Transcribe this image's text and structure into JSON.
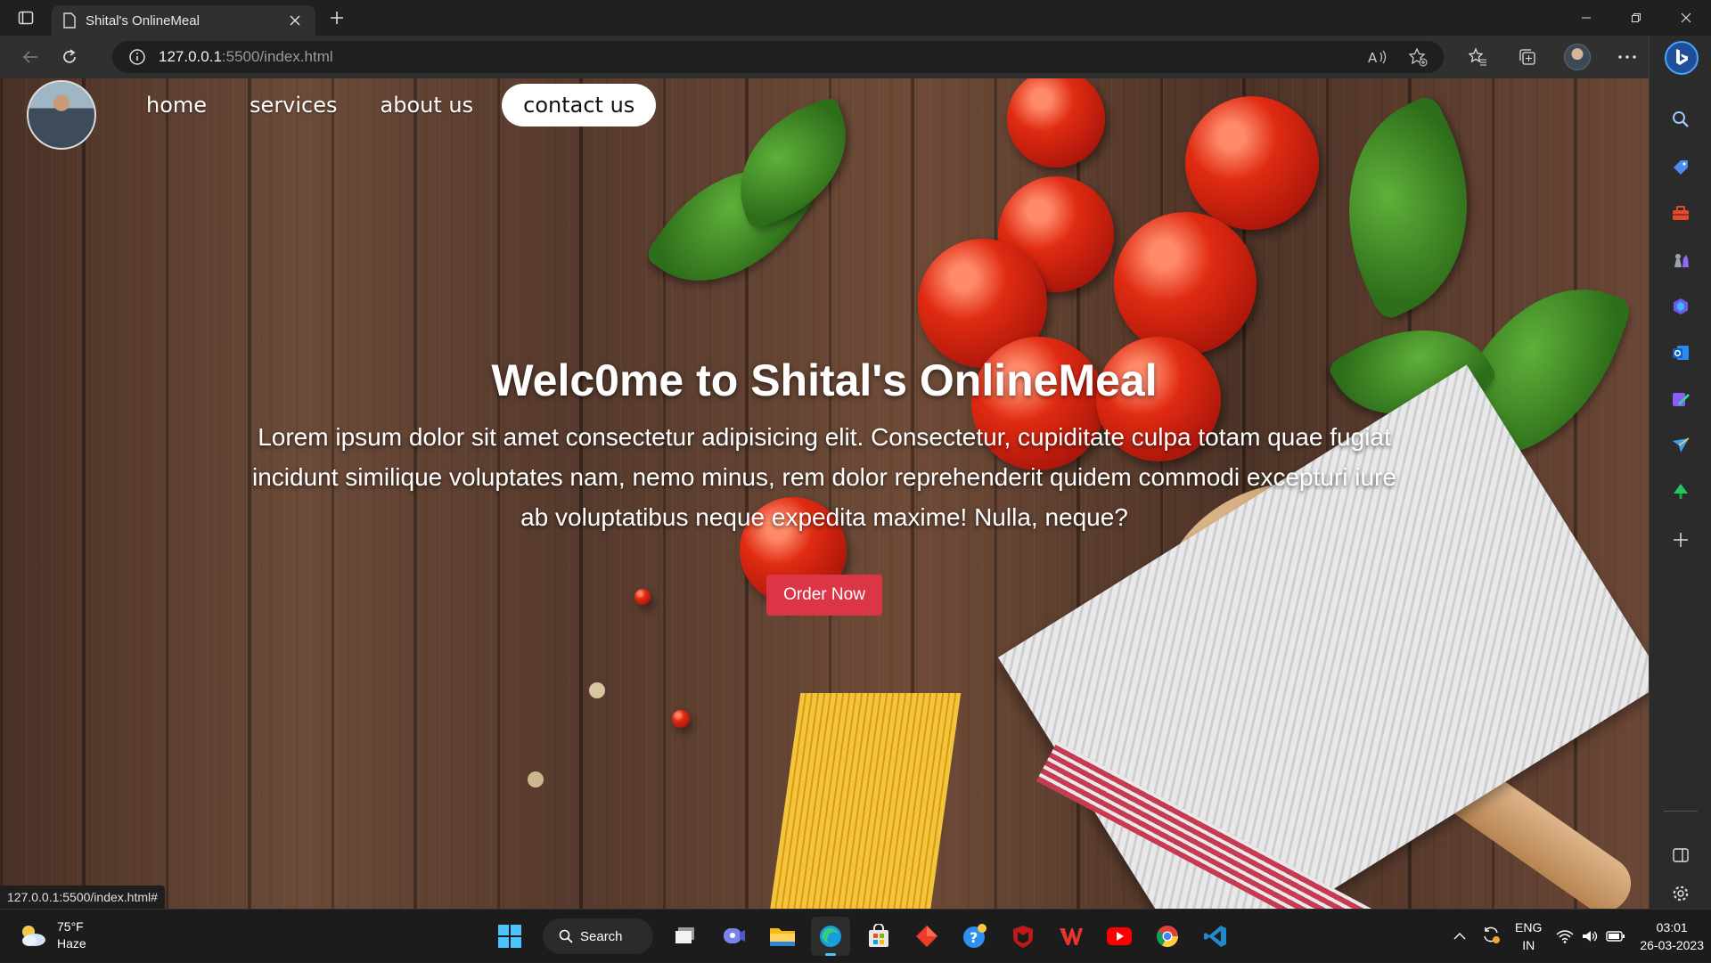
{
  "browser": {
    "tab_title": "Shital's OnlineMeal",
    "url_host": "127.0.0.1",
    "url_path": ":5500/index.html",
    "status_url": "127.0.0.1:5500/index.html#"
  },
  "nav": {
    "links": [
      "home",
      "services",
      "about us",
      "contact us"
    ],
    "active": "contact us"
  },
  "hero": {
    "title": "Welc0me to Shital's OnlineMeal",
    "body": "Lorem ipsum dolor sit amet consectetur adipisicing elit. Consectetur, cupiditate culpa totam quae fugiat incidunt similique voluptates nam, nemo minus, rem dolor reprehenderit quidem commodi excepturi iure ab voluptatibus neque expedita maxime! Nulla, neque?",
    "cta": "Order Now"
  },
  "taskbar": {
    "weather_temp": "75°F",
    "weather_desc": "Haze",
    "search_label": "Search",
    "lang_line1": "ENG",
    "lang_line2": "IN",
    "time": "03:01",
    "date": "26-03-2023"
  },
  "colors": {
    "cta": "#dc3545",
    "active_nav_bg": "#ffffff",
    "accent": "#4cc2ff"
  },
  "icons": {
    "sidebar": [
      "search-icon",
      "tag-icon",
      "toolbox-icon",
      "chess-icon",
      "copilot-icon",
      "outlook-icon",
      "designer-icon",
      "send-icon",
      "tree-icon",
      "add-icon",
      "sidebar-layout-icon",
      "settings-icon"
    ],
    "taskbar": [
      "windows-start-icon",
      "task-view-icon",
      "teams-icon",
      "file-explorer-icon",
      "edge-icon",
      "store-icon",
      "diamond-app-icon",
      "help-icon",
      "mcafee-icon",
      "wps-icon",
      "youtube-icon",
      "chrome-icon",
      "vscode-icon"
    ]
  }
}
